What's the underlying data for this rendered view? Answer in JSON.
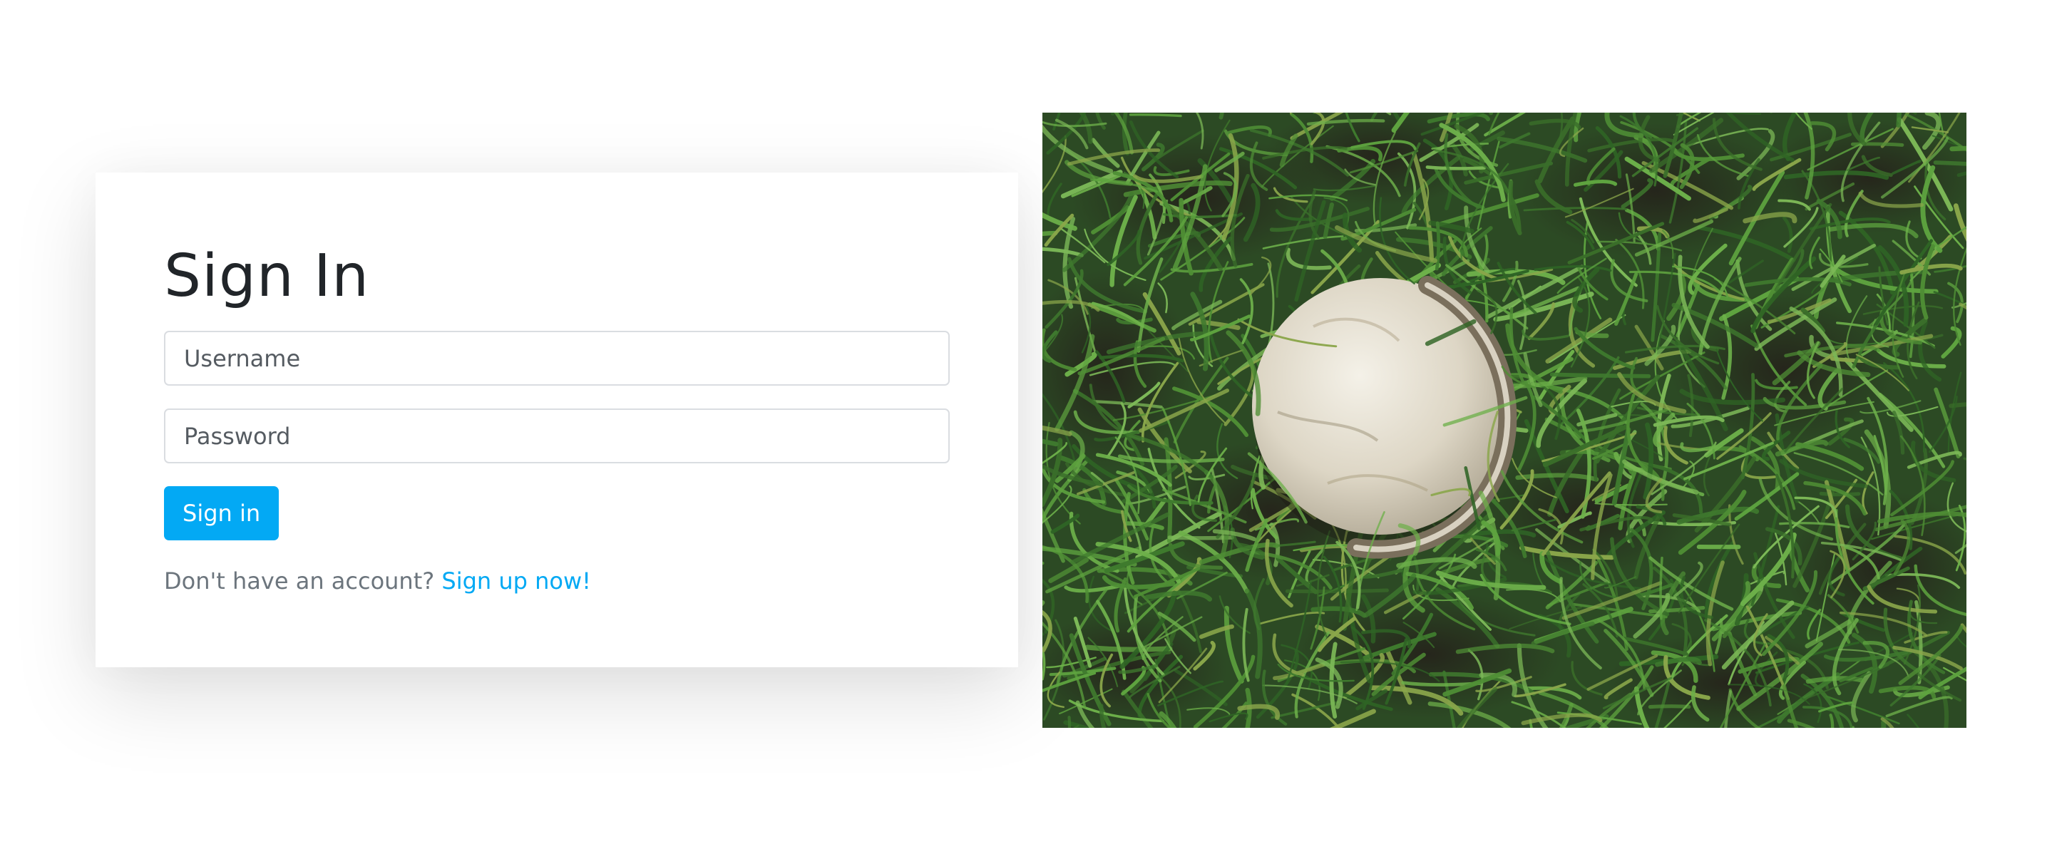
{
  "signin": {
    "title": "Sign In",
    "username_placeholder": "Username",
    "password_placeholder": "Password",
    "submit_label": "Sign in",
    "no_account_text": "Don't have an account?",
    "signup_link": "Sign up now!"
  },
  "colors": {
    "accent": "#03a9f4",
    "grass": "#2f5f2a",
    "soil": "#2b2620",
    "ball": "#e7e1d4"
  },
  "photo": {
    "subject": "hurling-ball-on-grass-image"
  }
}
